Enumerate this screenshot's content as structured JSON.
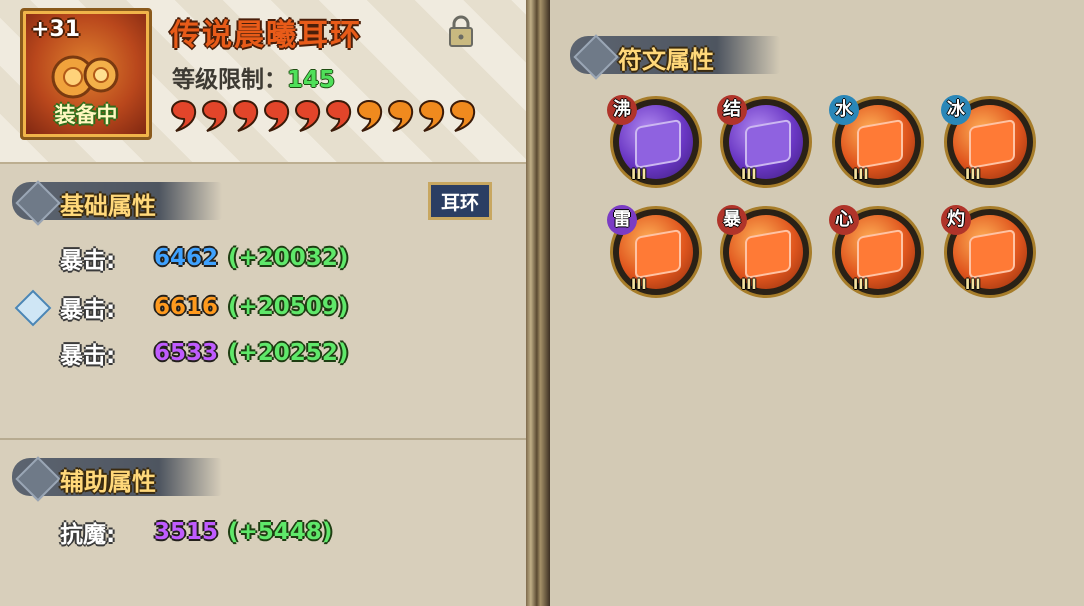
{
  "item": {
    "name": "传说晨曦耳环",
    "enhance_level": "+31",
    "status": "装备中",
    "level_label": "等级限制：",
    "level_value": "145",
    "stars": 10,
    "star_color": "#e2452a",
    "locked": true
  },
  "base_section": {
    "title": "基础属性",
    "equip_type": "耳环",
    "stats": [
      {
        "label": "暴击:",
        "value": "6462",
        "bonus": "(+20032)",
        "color": "#3fa2ff"
      },
      {
        "label": "暴击:",
        "value": "6616",
        "bonus": "(+20509)",
        "color": "#ff9a1e",
        "selected": true
      },
      {
        "label": "暴击:",
        "value": "6533",
        "bonus": "(+20252)",
        "color": "#c05cff"
      }
    ]
  },
  "aux_section": {
    "title": "辅助属性",
    "stats": [
      {
        "label": "抗魔:",
        "value": "3515",
        "bonus": "(+5448)",
        "color": "#c05cff"
      }
    ]
  },
  "rune_section": {
    "title": "符文属性",
    "runes": [
      {
        "tag": "沸",
        "color": "purple",
        "tag_color": "#b0342a",
        "grade": "III"
      },
      {
        "tag": "结",
        "color": "purple",
        "tag_color": "#b0342a",
        "grade": "III"
      },
      {
        "tag": "水",
        "color": "orange",
        "tag_color": "#2a87b8",
        "grade": "III"
      },
      {
        "tag": "冰",
        "color": "orange",
        "tag_color": "#2a87b8",
        "grade": "III"
      },
      {
        "tag": "雷",
        "color": "orange",
        "tag_color": "#7b3cc4",
        "grade": "III"
      },
      {
        "tag": "暴",
        "color": "orange",
        "tag_color": "#b0342a",
        "grade": "III"
      },
      {
        "tag": "心",
        "color": "orange",
        "tag_color": "#b0342a",
        "grade": "III"
      },
      {
        "tag": "灼",
        "color": "orange",
        "tag_color": "#b0342a",
        "grade": "III"
      }
    ]
  }
}
